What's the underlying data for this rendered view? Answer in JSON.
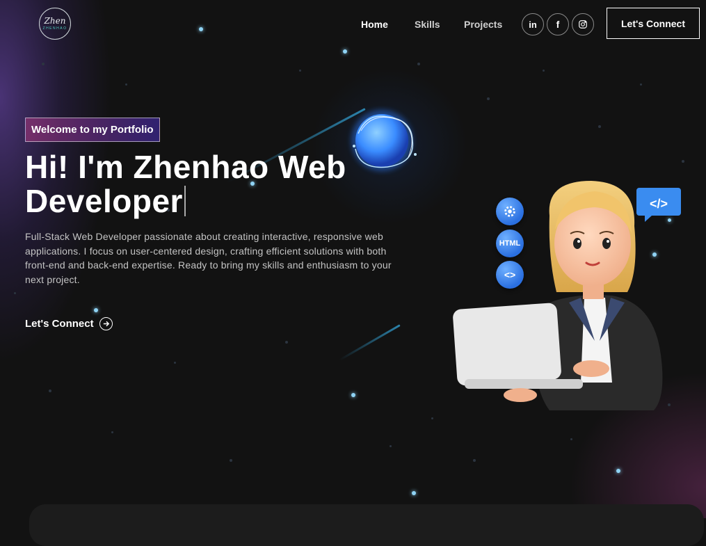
{
  "logo": {
    "script": "Zhen",
    "sub": "ZHENHAO"
  },
  "nav": {
    "links": [
      {
        "label": "Home",
        "active": true
      },
      {
        "label": "Skills",
        "active": false
      },
      {
        "label": "Projects",
        "active": false
      }
    ],
    "socials": [
      {
        "icon": "linkedin-icon",
        "glyph": "in"
      },
      {
        "icon": "facebook-icon",
        "glyph": "f"
      },
      {
        "icon": "instagram-icon",
        "glyph": ""
      }
    ],
    "cta_label": "Let's Connect"
  },
  "hero": {
    "tagline": "Welcome to my Portfolio",
    "headline": "Hi! I'm Zhenhao Web Developer",
    "description": "Full-Stack Web Developer passionate about creating interactive, responsive web applications. I focus on user-centered design, crafting efficient solutions with both front-end and back-end expertise. Ready to bring my skills and enthusiasm to your next project.",
    "cta_label": "Let's Connect"
  },
  "illustration": {
    "badges": [
      "gear-icon",
      "HTML",
      "<>"
    ],
    "bubble": "</>"
  },
  "colors": {
    "background": "#121212",
    "tag_gradient_start": "#aa367c",
    "tag_gradient_end": "#4a2fbd",
    "accent_blue": "#2a6fe0"
  }
}
